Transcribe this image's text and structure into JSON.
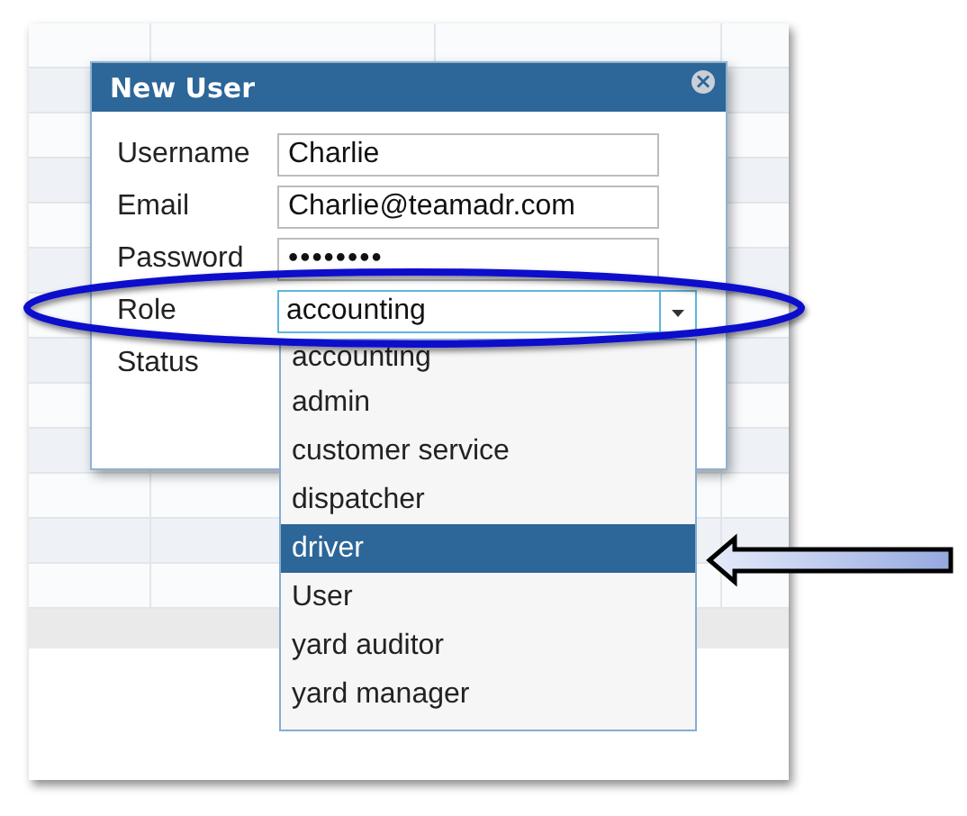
{
  "dialog": {
    "title": "New User",
    "close_glyph": "×",
    "fields": [
      {
        "label": "Username",
        "kind": "text",
        "value": "Charlie"
      },
      {
        "label": "Email",
        "kind": "text",
        "value": "Charlie@teamadr.com"
      },
      {
        "label": "Password",
        "kind": "password",
        "value": "••••••••"
      },
      {
        "label": "Role",
        "kind": "select",
        "value": "accounting",
        "expanded": true
      },
      {
        "label": "Status",
        "kind": "covered"
      }
    ]
  },
  "dropdown": {
    "options": [
      {
        "label": "accounting",
        "selected": false
      },
      {
        "label": "admin",
        "selected": false
      },
      {
        "label": "customer service",
        "selected": false
      },
      {
        "label": "dispatcher",
        "selected": false
      },
      {
        "label": "driver",
        "selected": true
      },
      {
        "label": "User",
        "selected": false
      },
      {
        "label": "yard auditor",
        "selected": false
      },
      {
        "label": "yard manager",
        "selected": false
      }
    ]
  }
}
